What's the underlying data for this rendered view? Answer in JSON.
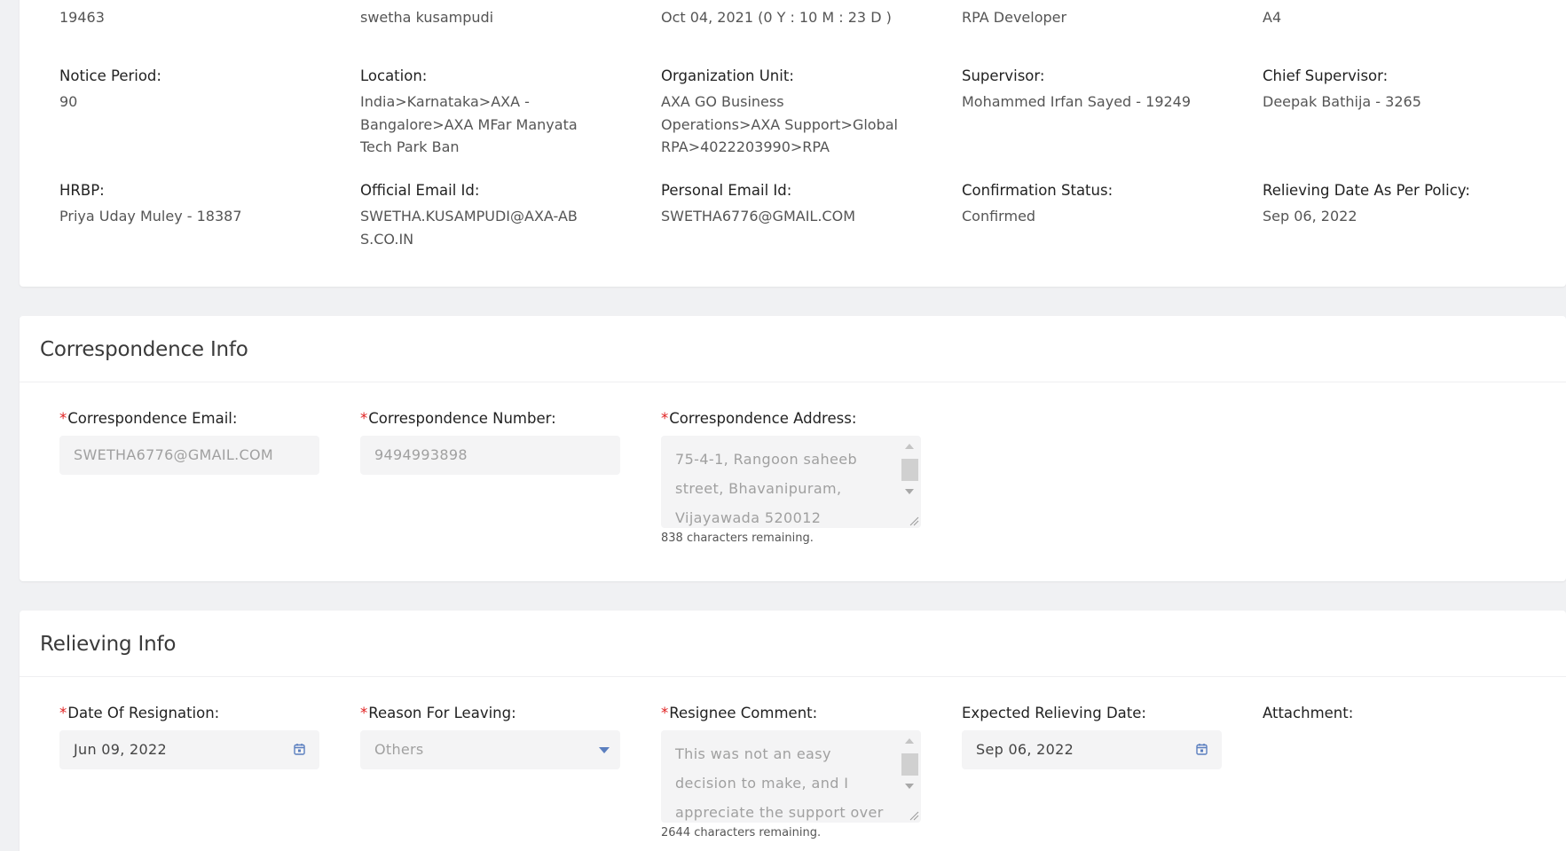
{
  "employee": {
    "row0": [
      "19463",
      "swetha kusampudi",
      "Oct 04, 2021 (0 Y : 10 M : 23 D )",
      "RPA Developer",
      "A4"
    ],
    "fields": [
      {
        "label": "Notice Period:",
        "value": "90"
      },
      {
        "label": "Location:",
        "value": "India>Karnataka>AXA - Bangalore>AXA MFar Manyata Tech Park Ban"
      },
      {
        "label": "Organization Unit:",
        "value": "AXA GO Business Operations>AXA Support>Global RPA>4022203990>RPA"
      },
      {
        "label": "Supervisor:",
        "value": "Mohammed Irfan Sayed - 19249"
      },
      {
        "label": "Chief Supervisor:",
        "value": "Deepak Bathija - 3265"
      },
      {
        "label": "HRBP:",
        "value": "Priya Uday Muley - 18387"
      },
      {
        "label": "Official Email Id:",
        "value": "SWETHA.KUSAMPUDI@AXA-ABS.CO.IN"
      },
      {
        "label": "Personal Email Id:",
        "value": "SWETHA6776@GMAIL.COM"
      },
      {
        "label": "Confirmation Status:",
        "value": "Confirmed"
      },
      {
        "label": "Relieving Date As Per Policy:",
        "value": "Sep 06, 2022"
      }
    ]
  },
  "correspondence": {
    "title": "Correspondence Info",
    "required_mark": "*",
    "email_label": "Correspondence Email:",
    "email_value": "SWETHA6776@GMAIL.COM",
    "number_label": "Correspondence Number:",
    "number_value": "9494993898",
    "address_label": "Correspondence Address:",
    "address_value": "75-4-1, Rangoon saheeb street, Bhavanipuram, Vijayawada 520012",
    "address_remaining": "838 characters remaining."
  },
  "relieving": {
    "title": "Relieving Info",
    "required_mark": "*",
    "resignation_label": "Date Of Resignation:",
    "resignation_value": "Jun 09, 2022",
    "reason_label": "Reason For Leaving:",
    "reason_value": "Others",
    "comment_label": "Resignee Comment:",
    "comment_value": "This was not an easy decision to make, and I appreciate the support over",
    "comment_remaining": "2644 characters remaining.",
    "expected_label": "Expected Relieving Date:",
    "expected_value": "Sep 06, 2022",
    "attachment_label": "Attachment:"
  },
  "icons": {
    "calendar": "calendar-icon",
    "dropdown": "chevron-down-icon",
    "accent": "#5b7fbf",
    "required": "#e02020"
  }
}
